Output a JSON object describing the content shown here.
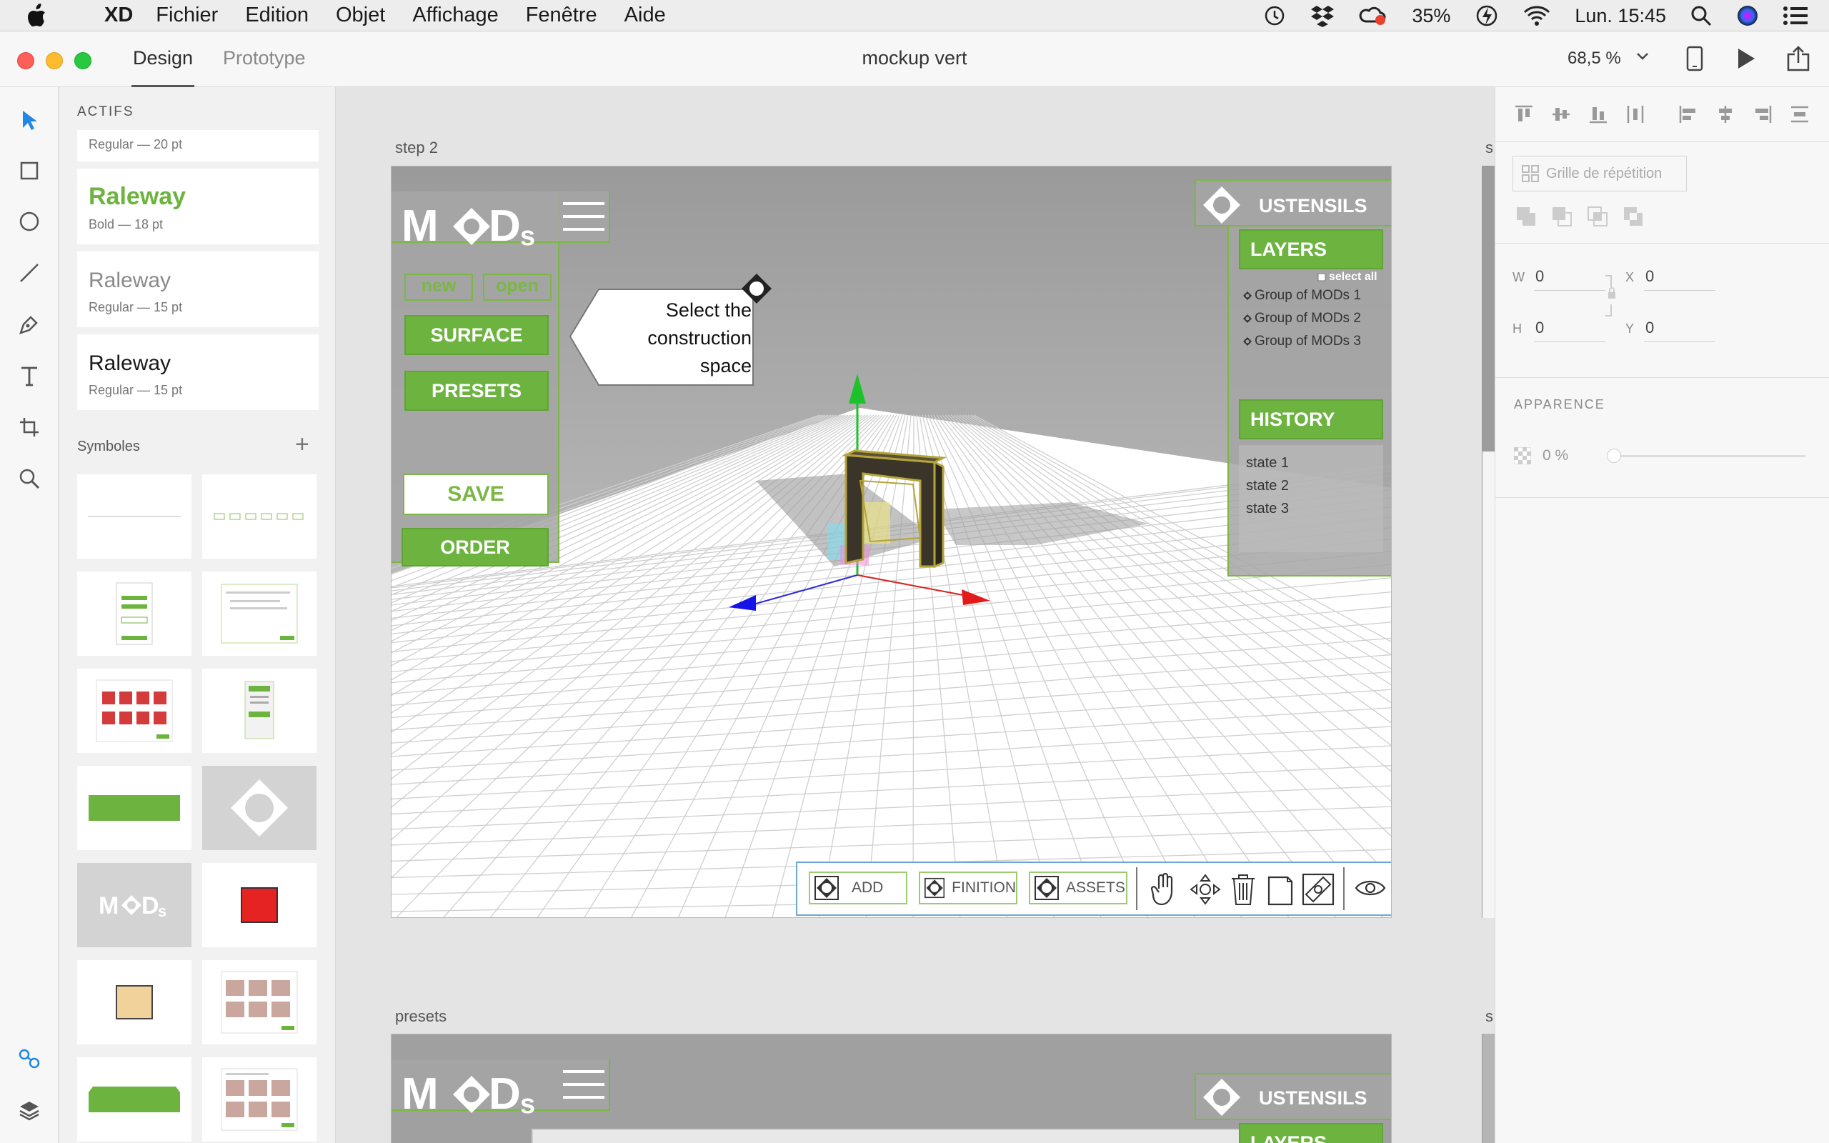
{
  "menubar": {
    "app": "XD",
    "items": [
      "Fichier",
      "Edition",
      "Objet",
      "Affichage",
      "Fenêtre",
      "Aide"
    ],
    "battery": "35%",
    "clock": "Lun. 15:45"
  },
  "titlebar": {
    "tabs": [
      "Design",
      "Prototype"
    ],
    "document_title": "mockup vert",
    "zoom": "68,5 %"
  },
  "assets": {
    "title": "ACTIFS",
    "fonts": [
      {
        "name": "",
        "meta": "Regular — 20 pt"
      },
      {
        "name": "Raleway",
        "meta": "Bold — 18 pt",
        "color": "#6db33f"
      },
      {
        "name": "Raleway",
        "meta": "Regular — 15 pt",
        "color": "#8a8a8a"
      },
      {
        "name": "Raleway",
        "meta": "Regular — 15 pt",
        "color": "#1a1a1a"
      }
    ],
    "symbols_label": "Symboles",
    "add_symbol": "+"
  },
  "canvas": {
    "artboard1_label": "step 2",
    "artboard2_label": "presets",
    "side_label_1": "s",
    "side_label_2": "s"
  },
  "mockup": {
    "logo": "MODs",
    "new": "new",
    "open": "open",
    "surface": "SURFACE",
    "presets": "PRESETS",
    "save": "SAVE",
    "order": "ORDER",
    "tooltip": [
      "Select the",
      "construction",
      "space"
    ],
    "ustensils": "USTENSILS",
    "layers": "LAYERS",
    "select_all": "select all",
    "layer_items": [
      "Group of MODs 1",
      "Group of MODs 2",
      "Group of MODs 3"
    ],
    "history": "HISTORY",
    "states": [
      "state 1",
      "state 2",
      "state 3"
    ],
    "toolbar": {
      "add": "ADD",
      "finition": "FINITION",
      "assets": "ASSETS"
    },
    "brand_green": "#6db33f"
  },
  "properties": {
    "repeat_grid": "Grille de répétition",
    "w_label": "W",
    "w": "0",
    "h_label": "H",
    "h": "0",
    "x_label": "X",
    "x": "0",
    "y_label": "Y",
    "y": "0",
    "appearance": "APPARENCE",
    "opacity": "0 %"
  }
}
